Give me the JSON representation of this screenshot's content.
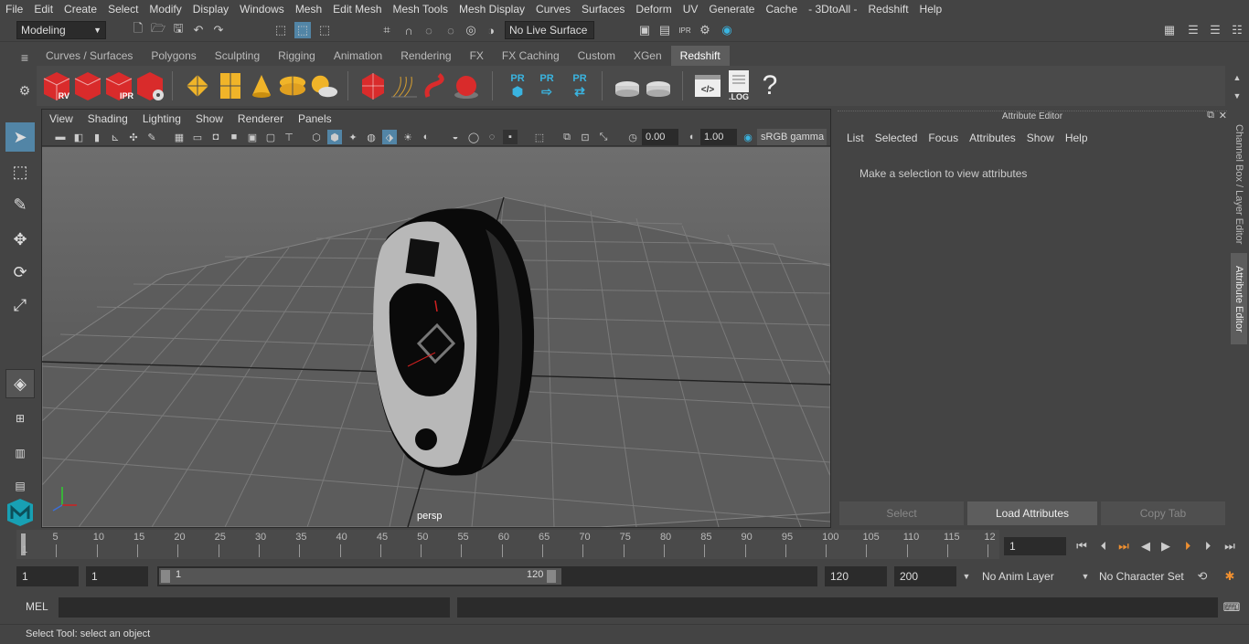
{
  "menus": [
    "File",
    "Edit",
    "Create",
    "Select",
    "Modify",
    "Display",
    "Windows",
    "Mesh",
    "Edit Mesh",
    "Mesh Tools",
    "Mesh Display",
    "Curves",
    "Surfaces",
    "Deform",
    "UV",
    "Generate",
    "Cache",
    "- 3DtoAll -",
    "Redshift",
    "Help"
  ],
  "status": {
    "mode": "Modeling",
    "live_surface": "No Live Surface"
  },
  "shelf_tabs": [
    "Curves / Surfaces",
    "Polygons",
    "Sculpting",
    "Rigging",
    "Animation",
    "Rendering",
    "FX",
    "FX Caching",
    "Custom",
    "XGen",
    "Redshift"
  ],
  "shelf_active": "Redshift",
  "shelf_buttons": {
    "rv": "RV",
    "ipr": "IPR",
    "pr1": "PR",
    "pr2": "PR",
    "pr3": "PR",
    "log": ".LOG",
    "help": "?"
  },
  "panel_menu": [
    "View",
    "Shading",
    "Lighting",
    "Show",
    "Renderer",
    "Panels"
  ],
  "panel_toolbar": {
    "exposure": "0.00",
    "gamma": "1.00",
    "color_space": "sRGB gamma"
  },
  "viewport": {
    "camera": "persp"
  },
  "attr_editor": {
    "title": "Attribute Editor",
    "menu": [
      "List",
      "Selected",
      "Focus",
      "Attributes",
      "Show",
      "Help"
    ],
    "message": "Make a selection to view attributes",
    "buttons": {
      "select": "Select",
      "load": "Load Attributes",
      "copy": "Copy Tab"
    }
  },
  "side_tabs": {
    "channel": "Channel Box / Layer Editor",
    "attr": "Attribute Editor"
  },
  "timeline": {
    "ticks": [
      "5",
      "10",
      "15",
      "20",
      "25",
      "30",
      "35",
      "40",
      "45",
      "50",
      "55",
      "60",
      "65",
      "70",
      "75",
      "80",
      "85",
      "90",
      "95",
      "100",
      "105",
      "110",
      "115",
      "12"
    ],
    "start_label": "1",
    "current_frame": "1"
  },
  "range": {
    "start": "1",
    "playback_start": "1",
    "slider_start": "1",
    "slider_end": "120",
    "playback_end": "120",
    "end": "200",
    "anim_layer": "No Anim Layer",
    "char_set": "No Character Set"
  },
  "command": {
    "lang": "MEL"
  },
  "help_line": "Select Tool: select an object"
}
